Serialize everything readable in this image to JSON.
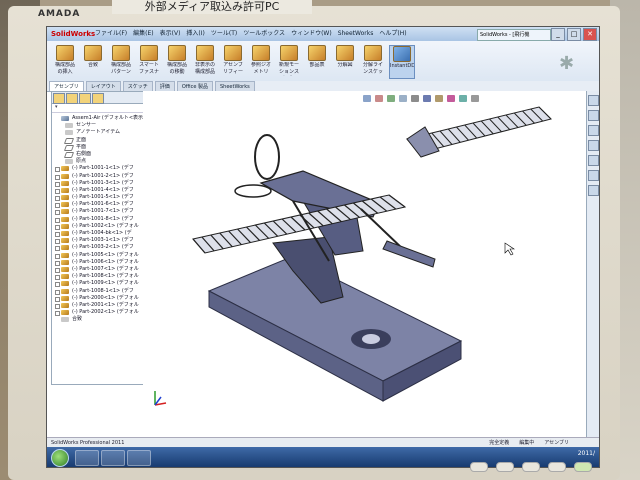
{
  "scene": {
    "sign_text": "外部メディア取込み許可PC",
    "monitor_brand": "AMADA"
  },
  "app": {
    "name": "SolidWorks",
    "window_title": "SolidWorks - [飛行機",
    "menus": [
      "ファイル(F)",
      "編集(E)",
      "表示(V)",
      "挿入(I)",
      "ツール(T)",
      "ツールボックス",
      "ウィンドウ(W)",
      "SheetWorks",
      "ヘルプ(H)"
    ],
    "window_buttons": [
      "_",
      "□",
      "✕"
    ]
  },
  "ribbon": {
    "buttons": [
      {
        "label": "構成部品の挿入",
        "icon": "insert-component-icon"
      },
      {
        "label": "合致",
        "icon": "mate-icon"
      },
      {
        "label": "構成部品パターン",
        "icon": "component-pattern-icon"
      },
      {
        "label": "スマートファスナー",
        "icon": "smart-fastener-icon"
      },
      {
        "label": "構成部品の移動",
        "icon": "move-component-icon"
      },
      {
        "label": "非表示の構成部品",
        "icon": "hidden-component-icon"
      },
      {
        "label": "アセンブリフィーチャー",
        "icon": "assembly-feature-icon"
      },
      {
        "label": "参照ジオメトリ",
        "icon": "reference-geometry-icon"
      },
      {
        "label": "新規モーションスタディ",
        "icon": "motion-study-icon"
      },
      {
        "label": "部品表",
        "icon": "bom-icon"
      },
      {
        "label": "分解図",
        "icon": "exploded-view-icon"
      },
      {
        "label": "分解ラインスケッチ",
        "icon": "explode-line-icon"
      },
      {
        "label": "InstantDD",
        "icon": "instant3d-icon"
      }
    ]
  },
  "command_tabs": [
    "アセンブリ",
    "レイアウト",
    "スケッチ",
    "評価",
    "Office 製品",
    "SheetWorks"
  ],
  "feature_tree": {
    "root": "Assem1-Air (デフォルト<表示状態",
    "items": [
      {
        "label": "センサー",
        "kind": "misc",
        "level": 1
      },
      {
        "label": "アノテートアイテム",
        "kind": "misc",
        "level": 1
      },
      {
        "label": "正面",
        "kind": "plane",
        "level": 1
      },
      {
        "label": "平面",
        "kind": "plane",
        "level": 1
      },
      {
        "label": "右側面",
        "kind": "plane",
        "level": 1
      },
      {
        "label": "原点",
        "kind": "misc",
        "level": 1
      },
      {
        "label": "(-) Part-1001-1<1> (デフ",
        "kind": "part",
        "level": 0
      },
      {
        "label": "(-) Part-1001-2<1> (デフ",
        "kind": "part",
        "level": 0
      },
      {
        "label": "(-) Part-1001-3<1> (デフ",
        "kind": "part",
        "level": 0
      },
      {
        "label": "(-) Part-1001-4<1> (デフ",
        "kind": "part",
        "level": 0
      },
      {
        "label": "(-) Part-1001-5<1> (デフ",
        "kind": "part",
        "level": 0
      },
      {
        "label": "(-) Part-1001-6<1> (デフ",
        "kind": "part",
        "level": 0
      },
      {
        "label": "(-) Part-1001-7<1> (デフ",
        "kind": "part",
        "level": 0
      },
      {
        "label": "(-) Part-1001-8<1> (デフ",
        "kind": "part",
        "level": 0
      },
      {
        "label": "(-) Part-1002<1> (デフォル",
        "kind": "part",
        "level": 0
      },
      {
        "label": "(-) Part-1004-bk<1> (デ",
        "kind": "part",
        "level": 0
      },
      {
        "label": "(-) Part-1003-1<1> (デフ",
        "kind": "part",
        "level": 0
      },
      {
        "label": "(-) Part-1003-2<1> (デフ",
        "kind": "part",
        "level": 0
      },
      {
        "label": "(-) Part-1005<1> (デフォル",
        "kind": "part",
        "level": 0
      },
      {
        "label": "(-) Part-1006<1> (デフォル",
        "kind": "part",
        "level": 0
      },
      {
        "label": "(-) Part-1007<1> (デフォル",
        "kind": "part",
        "level": 0
      },
      {
        "label": "(-) Part-1008<1> (デフォル",
        "kind": "part",
        "level": 0
      },
      {
        "label": "(-) Part-1009<1> (デフォル",
        "kind": "part",
        "level": 0
      },
      {
        "label": "(-) Part-1008-1<1> (デフ",
        "kind": "part",
        "level": 0
      },
      {
        "label": "(-) Part-2000<1> (デフォル",
        "kind": "part",
        "level": 0
      },
      {
        "label": "(-) Part-2001<1> (デフォル",
        "kind": "part",
        "level": 0
      },
      {
        "label": "(-) Part-2002<1> (デフォル",
        "kind": "part",
        "level": 0
      },
      {
        "label": "合致",
        "kind": "misc",
        "level": 0
      }
    ]
  },
  "statusbar": {
    "left": "SolidWorks Professional 2011",
    "right": [
      "完全定義",
      "編集中",
      "アセンブリ"
    ]
  },
  "taskbar": {
    "clock": "2011/"
  },
  "colors": {
    "model_fill": "#7d83a6",
    "model_edge": "#2c2f45",
    "model_dark": "#454a6a",
    "ribbon_bg": "#dde7f3"
  }
}
